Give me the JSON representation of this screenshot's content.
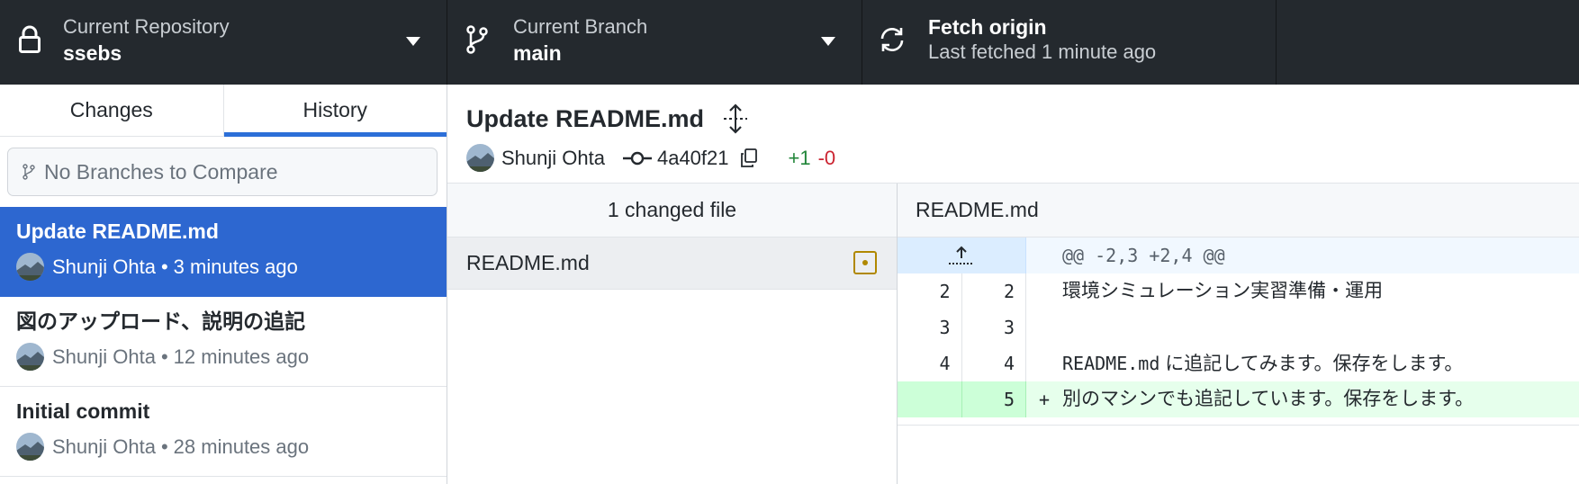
{
  "toolbar": {
    "repository": {
      "description": "Current Repository",
      "title": "ssebs"
    },
    "branch": {
      "description": "Current Branch",
      "title": "main"
    },
    "fetch": {
      "title": "Fetch origin",
      "description": "Last fetched 1 minute ago"
    }
  },
  "sidebar": {
    "tabs": [
      {
        "label": "Changes",
        "active": false
      },
      {
        "label": "History",
        "active": true
      }
    ],
    "compare_placeholder": "No Branches to Compare",
    "commits": [
      {
        "title": "Update README.md",
        "author": "Shunji Ohta",
        "separator": "•",
        "time": "3 minutes ago",
        "selected": true
      },
      {
        "title": "図のアップロード、説明の追記",
        "author": "Shunji Ohta",
        "separator": "•",
        "time": "12 minutes ago",
        "selected": false
      },
      {
        "title": "Initial commit",
        "author": "Shunji Ohta",
        "separator": "•",
        "time": "28 minutes ago",
        "selected": false
      }
    ]
  },
  "commit_detail": {
    "title": "Update README.md",
    "author": "Shunji Ohta",
    "sha": "4a40f21",
    "additions": "+1",
    "deletions": "-0"
  },
  "files": {
    "header": "1 changed file",
    "items": [
      {
        "name": "README.md",
        "status": "modified"
      }
    ]
  },
  "diff": {
    "file_name": "README.md",
    "hunk_header": "@@ -2,3 +2,4 @@",
    "lines": [
      {
        "old": "2",
        "new": "2",
        "marker": "",
        "text": "環境シミュレーション実習準備・運用"
      },
      {
        "old": "3",
        "new": "3",
        "marker": "",
        "text": ""
      },
      {
        "old": "4",
        "new": "4",
        "marker": "",
        "code_text": "README.md",
        "text": " に追記してみます。保存をします。"
      },
      {
        "old": "",
        "new": "5",
        "marker": "+",
        "text": "別のマシンでも追記しています。保存をします。"
      }
    ]
  },
  "colors": {
    "toolbar_bg": "#24292e",
    "selection_blue": "#2d67d0",
    "added_green": "#22863a",
    "removed_red": "#cb2431",
    "modified_yellow": "#b08800"
  },
  "icons": {
    "repository": "lock-icon",
    "branch": "git-branch-icon",
    "fetch": "sync-icon",
    "caret": "triangle-down-icon",
    "commit_sha": "git-commit-icon",
    "copy": "copy-icon",
    "expand": "expand-arrows-icon",
    "file_status": "file-modified-icon",
    "hunk_expand": "expand-up-icon"
  }
}
